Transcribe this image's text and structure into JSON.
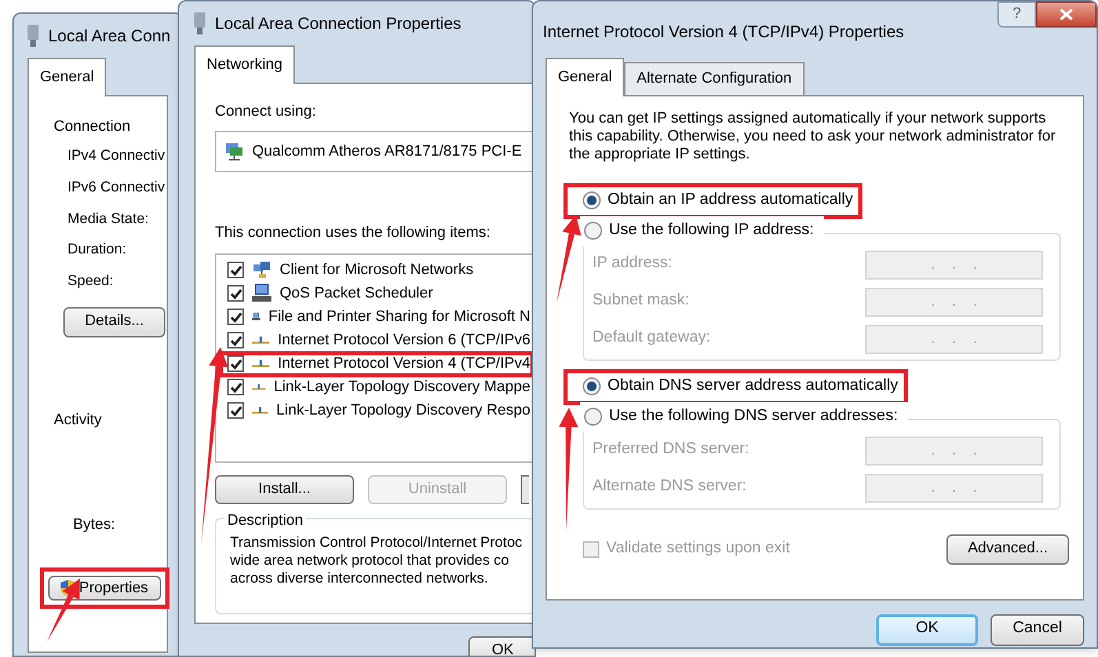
{
  "status_window": {
    "title": "Local Area Conn",
    "tabs": [
      {
        "label": "General",
        "selected": true
      }
    ],
    "connection_heading": "Connection",
    "connection_fields": [
      "IPv4 Connectiv",
      "IPv6 Connectiv",
      "Media State:",
      "Duration:",
      "Speed:"
    ],
    "details_button": "Details...",
    "activity_heading": "Activity",
    "bytes_label": "Bytes:",
    "properties_button": {
      "label": "Properties",
      "highlighted": true
    }
  },
  "properties_window": {
    "title": "Local Area Connection Properties",
    "tabs": [
      {
        "label": "Networking",
        "selected": true
      }
    ],
    "connect_using_label": "Connect using:",
    "adapter": "Qualcomm Atheros AR8171/8175 PCI-E",
    "items_label": "This connection uses the following items:",
    "items": [
      {
        "kind": "client",
        "label": "Client for Microsoft Networks",
        "checked": true,
        "highlighted": false
      },
      {
        "kind": "service",
        "label": "QoS Packet Scheduler",
        "checked": true,
        "highlighted": false
      },
      {
        "kind": "service",
        "label": "File and Printer Sharing for Microsoft N",
        "checked": true,
        "highlighted": false
      },
      {
        "kind": "protocol",
        "label": "Internet Protocol Version 6 (TCP/IPv6",
        "checked": true,
        "highlighted": false
      },
      {
        "kind": "protocol",
        "label": "Internet Protocol Version 4 (TCP/IPv4",
        "checked": true,
        "highlighted": true
      },
      {
        "kind": "protocol",
        "label": "Link-Layer Topology Discovery Mappe",
        "checked": true,
        "highlighted": false
      },
      {
        "kind": "protocol",
        "label": "Link-Layer Topology Discovery Respo",
        "checked": true,
        "highlighted": false
      }
    ],
    "buttons": [
      {
        "label": "Install...",
        "disabled": false
      },
      {
        "label": "Uninstall",
        "disabled": true
      }
    ],
    "description_heading": "Description",
    "description_lines": [
      "Transmission Control Protocol/Internet Protoc",
      "wide area network protocol that provides co",
      "across diverse interconnected networks."
    ],
    "ok_button": "OK"
  },
  "ipv4_window": {
    "title": "Internet Protocol Version 4 (TCP/IPv4) Properties",
    "help_button": "?",
    "tabs": [
      {
        "label": "General",
        "selected": true
      },
      {
        "label": "Alternate Configuration",
        "selected": false
      }
    ],
    "intro": "You can get IP settings assigned automatically if your network supports this capability. Otherwise, you need to ask your network administrator for the appropriate IP settings.",
    "ip_options": [
      {
        "label": "Obtain an IP address automatically",
        "selected": true,
        "highlighted": true
      },
      {
        "label": "Use the following IP address:",
        "selected": false,
        "highlighted": false
      }
    ],
    "ip_fields": [
      {
        "label": "IP address:",
        "value": ".    .    .",
        "disabled": true
      },
      {
        "label": "Subnet mask:",
        "value": ".    .    .",
        "disabled": true
      },
      {
        "label": "Default gateway:",
        "value": ".    .    .",
        "disabled": true
      }
    ],
    "dns_options": [
      {
        "label": "Obtain DNS server address automatically",
        "selected": true,
        "highlighted": true
      },
      {
        "label": "Use the following DNS server addresses:",
        "selected": false,
        "highlighted": false
      }
    ],
    "dns_fields": [
      {
        "label": "Preferred DNS server:",
        "value": ".    .    .",
        "disabled": true
      },
      {
        "label": "Alternate DNS server:",
        "value": ".    .    .",
        "disabled": true
      }
    ],
    "validate": {
      "label": "Validate settings upon exit",
      "checked": false,
      "disabled": true
    },
    "advanced_button": "Advanced...",
    "ok_button": "OK",
    "cancel_button": "Cancel"
  }
}
